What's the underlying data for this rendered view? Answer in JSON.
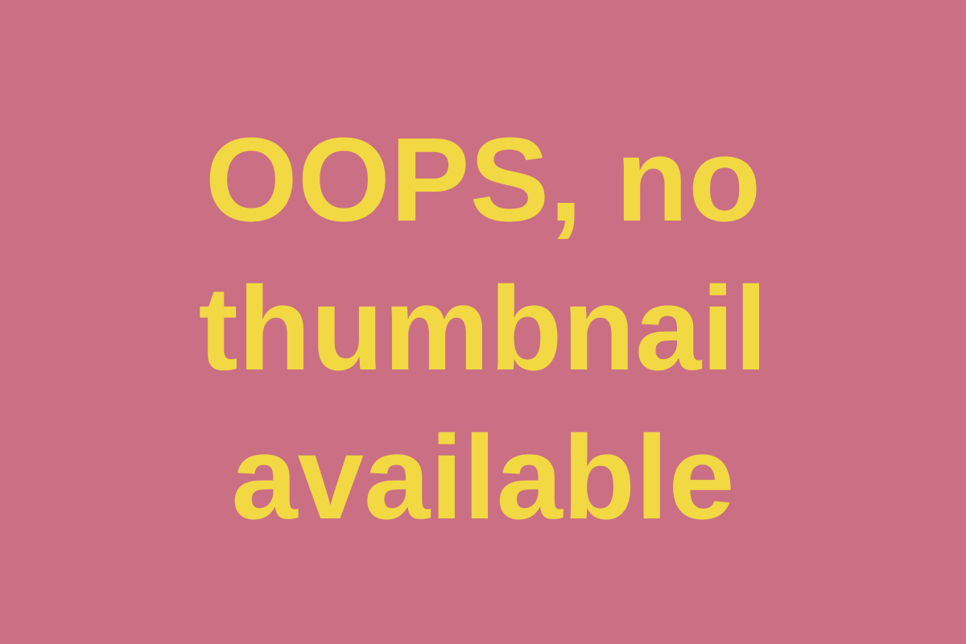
{
  "message": {
    "line1": "OOPS, no",
    "line2": "thumbnail",
    "line3": "available"
  },
  "colors": {
    "background": "#cb6f84",
    "text": "#f2d843"
  }
}
